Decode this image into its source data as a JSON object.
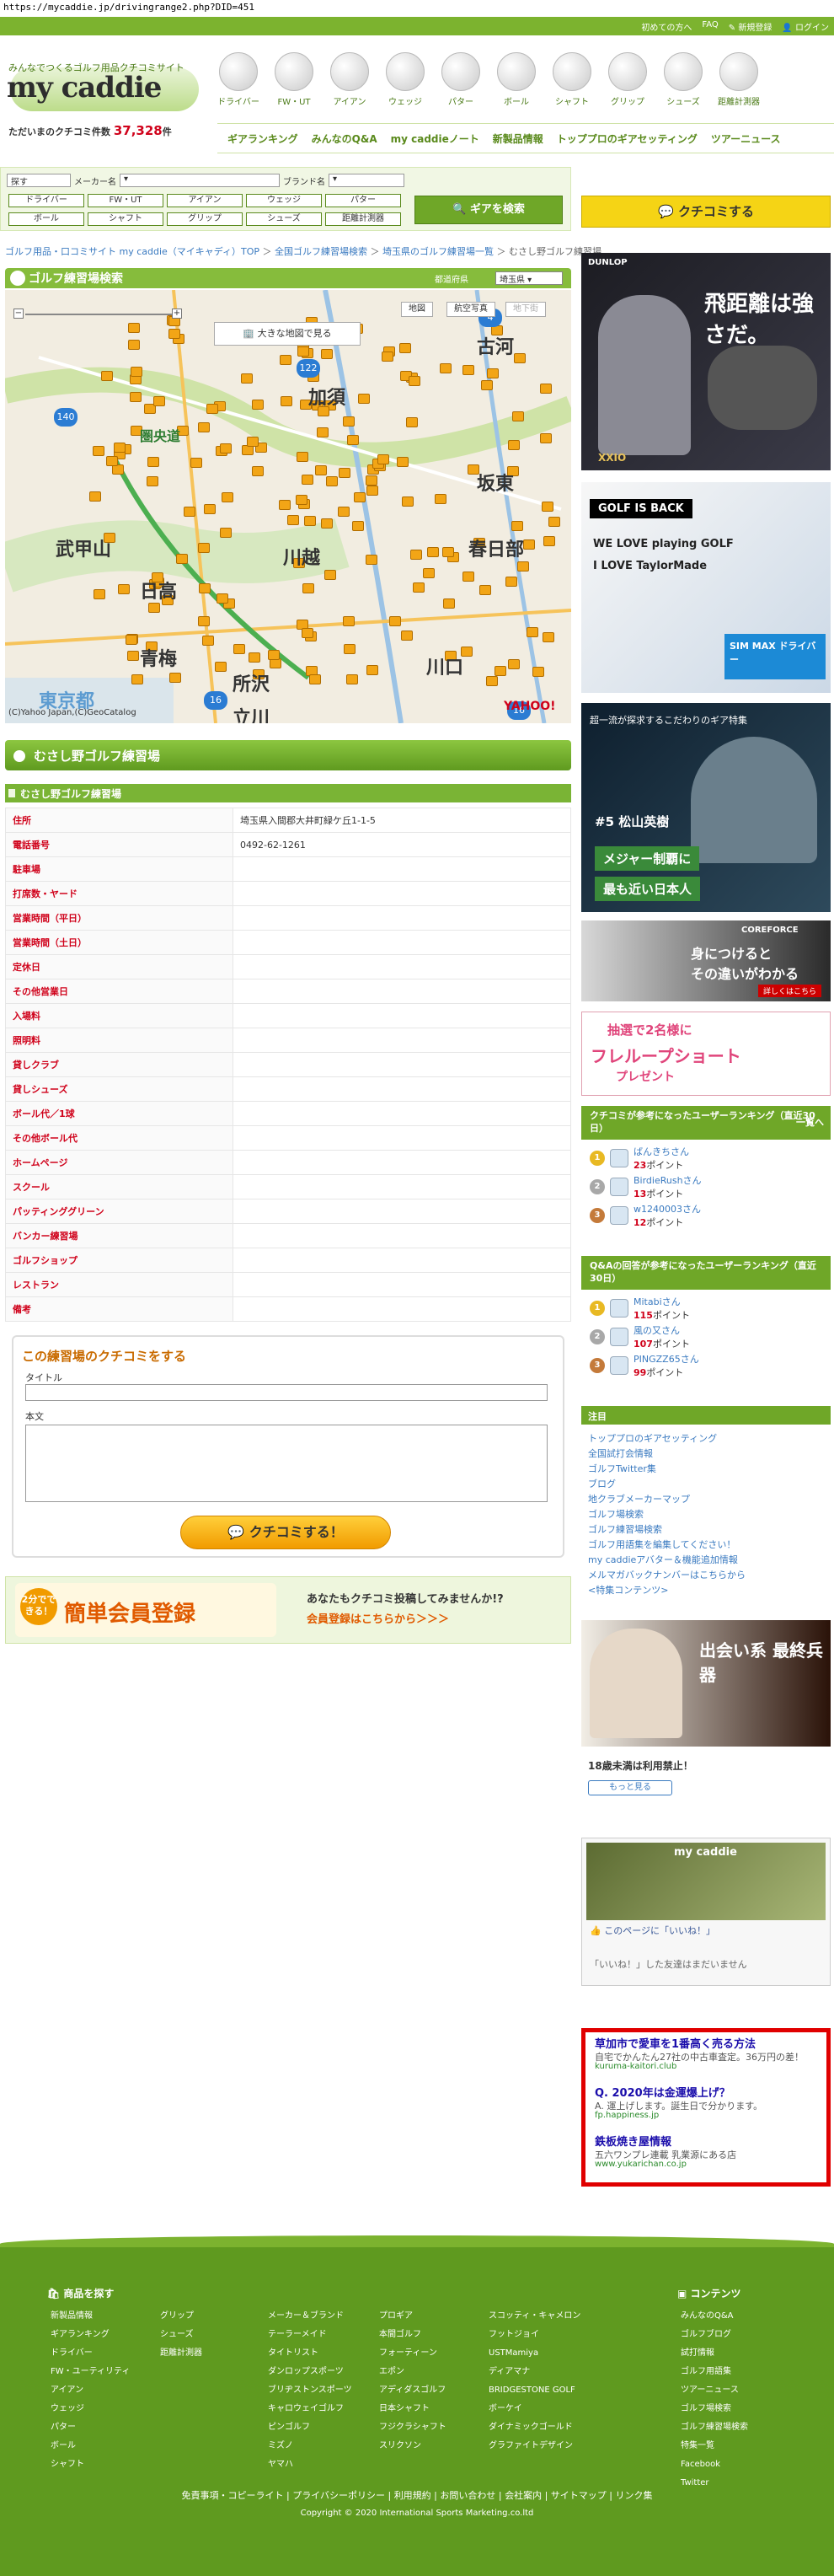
{
  "url": "https://mycaddie.jp/drivingrange2.php?DID=451",
  "top_links": [
    "初めての方へ",
    "FAQ",
    "新規登録",
    "ログイン"
  ],
  "logo": {
    "tagline": "みんなでつくるゴルフ用品クチコミサイト",
    "name": "my caddie"
  },
  "review_count": {
    "label": "ただいまのクチコミ件数",
    "value": "37,328",
    "unit": "件"
  },
  "categories": [
    "ドライバー",
    "FW・UT",
    "アイアン",
    "ウェッジ",
    "パター",
    "ボール",
    "シャフト",
    "グリップ",
    "シューズ",
    "距離計測器"
  ],
  "subnav": [
    "ギアランキング",
    "みんなのQ&A",
    "my caddieノート",
    "新製品情報",
    "トッププロのギアセッティング",
    "ツアーニュース"
  ],
  "search": {
    "filters": [
      {
        "label": "探す",
        "value": "探す"
      },
      {
        "label": "メーカー名",
        "value": ""
      },
      {
        "label": "ブランド名",
        "value": ""
      }
    ],
    "buttons": [
      "ドライバー",
      "FW・UT",
      "アイアン",
      "ウェッジ",
      "パター",
      "ボール",
      "シャフト",
      "グリップ",
      "シューズ",
      "距離計測器"
    ],
    "gear_search_label": "ギアを検索",
    "kuchikomi_label": "クチコミする"
  },
  "breadcrumb": [
    "ゴルフ用品・口コミサイト my caddie（マイキャディ）TOP",
    "全国ゴルフ練習場検索",
    "埼玉県のゴルフ練習場一覧",
    "むさし野ゴルフ練習場"
  ],
  "map": {
    "title": "ゴルフ練習場検索",
    "filter_label": "都道府県",
    "filter_value": "埼玉県",
    "types": [
      "地図",
      "航空写真",
      "地下街"
    ],
    "big_map_label": "大きな地図で見る",
    "credit": "(C)Yahoo Japan,(C)GeoCatalog",
    "brand": "YAHOO!",
    "places": [
      "古河",
      "加須",
      "坂東",
      "武甲山",
      "春日部",
      "日高",
      "川越",
      "青梅",
      "所沢",
      "川口",
      "東京都",
      "立川",
      "圏央道"
    ],
    "route_numbers": [
      "140",
      "122",
      "4",
      "16",
      "16"
    ]
  },
  "facility": {
    "name": "むさし野ゴルフ練習場",
    "subtitle": "むさし野ゴルフ練習場",
    "rows": [
      {
        "k": "住所",
        "v": "埼玉県入間郡大井町緑ケ丘1-1-5"
      },
      {
        "k": "電話番号",
        "v": "0492-62-1261"
      },
      {
        "k": "駐車場",
        "v": ""
      },
      {
        "k": "打席数・ヤード",
        "v": ""
      },
      {
        "k": "営業時間（平日）",
        "v": ""
      },
      {
        "k": "営業時間（土日）",
        "v": ""
      },
      {
        "k": "定休日",
        "v": ""
      },
      {
        "k": "その他営業日",
        "v": ""
      },
      {
        "k": "入場料",
        "v": ""
      },
      {
        "k": "照明料",
        "v": ""
      },
      {
        "k": "貸しクラブ",
        "v": ""
      },
      {
        "k": "貸しシューズ",
        "v": ""
      },
      {
        "k": "ボール代／1球",
        "v": ""
      },
      {
        "k": "その他ボール代",
        "v": ""
      },
      {
        "k": "ホームページ",
        "v": ""
      },
      {
        "k": "スクール",
        "v": ""
      },
      {
        "k": "パッティンググリーン",
        "v": ""
      },
      {
        "k": "バンカー練習場",
        "v": ""
      },
      {
        "k": "ゴルフショップ",
        "v": ""
      },
      {
        "k": "レストラン",
        "v": ""
      },
      {
        "k": "備考",
        "v": ""
      }
    ]
  },
  "review_form": {
    "title": "この練習場のクチコミをする",
    "title_label": "タイトル",
    "body_label": "本文",
    "submit_label": "クチコミする！"
  },
  "register": {
    "badge": "2分でできる！",
    "main": "簡単会員登録",
    "question": "あなたもクチコミ投稿してみませんか!?",
    "link": "会員登録はこちらから＞＞＞"
  },
  "ads": {
    "ad1": {
      "brand": "DUNLOP",
      "headline": "飛距離は強さだ。",
      "product": "XXIO"
    },
    "ad2": {
      "badge": "GOLF IS BACK",
      "line1": "WE LOVE playing GOLF",
      "line2": "I LOVE TaylorMade",
      "line3": "SIM MAX ドライバー"
    },
    "ad3": {
      "top": "超一流が探求するこだわりのギア特集",
      "player": "#5 松山英樹",
      "line1": "メジャー制覇に",
      "line2": "最も近い日本人"
    },
    "ad4": {
      "brand": "COREFORCE",
      "line1": "身につけると",
      "line2": "その違いがわかる",
      "cta": "詳しくはこちら"
    },
    "ad5": {
      "line1": "抽選で2名様に",
      "line2": "フレループショート",
      "line3": "プレゼント"
    }
  },
  "ranking_review": {
    "title": "クチコミが参考になったユーザーランキング（直近30日）",
    "more": "一覧へ",
    "rows": [
      {
        "rank": "1",
        "name": "ばんきちさん",
        "points": "23",
        "unit": "ポイント"
      },
      {
        "rank": "2",
        "name": "BirdieRushさん",
        "points": "13",
        "unit": "ポイント"
      },
      {
        "rank": "3",
        "name": "w1240003さん",
        "points": "12",
        "unit": "ポイント"
      }
    ]
  },
  "ranking_qa": {
    "title": "Q&Aの回答が参考になったユーザーランキング（直近30日）",
    "rows": [
      {
        "rank": "1",
        "name": "Mitabiさん",
        "points": "115",
        "unit": "ポイント"
      },
      {
        "rank": "2",
        "name": "風の又さん",
        "points": "107",
        "unit": "ポイント"
      },
      {
        "rank": "3",
        "name": "PINGZZ65さん",
        "points": "99",
        "unit": "ポイント"
      }
    ]
  },
  "notice": {
    "title": "注目",
    "items": [
      "トッププロのギアセッティング",
      "全国試打会情報",
      "ゴルフTwitter集",
      "ブログ",
      "地クラブメーカーマップ",
      "ゴルフ場検索",
      "ゴルフ練習場検索",
      "ゴルフ用語集を編集してください！",
      "my caddieアバター＆機能追加情報",
      "メルマガバックナンバーはこちらから",
      "<特集コンテンツ>"
    ]
  },
  "ad6": {
    "caption": "18歳未満は利用禁止！",
    "button": "もっと見る",
    "headline": "出会い系 最終兵器"
  },
  "facebook": {
    "title": "my caddie",
    "like": "このページに「いいね！」",
    "none": "「いいね！」した友達はまだいません"
  },
  "text_ads": [
    {
      "title": "草加市で愛車を1番高く売る方法",
      "desc": "自宅でかんたん27社の中古車査定。36万円の差！",
      "url": "kuruma-kaitori.club"
    },
    {
      "title": "Q. 2020年は金運爆上げ？",
      "desc": "A. 運上げします。誕生日で分かります。",
      "url": "fp.happiness.jp"
    },
    {
      "title": "鉄板焼き屋情報",
      "desc": "五六ワンプレ連載 乳業源にある店",
      "url": "www.yukarichan.co.jp"
    }
  ],
  "footer": {
    "products_title": "商品を探す",
    "contents_title": "コンテンツ",
    "col1": [
      "新製品情報",
      "ギアランキング",
      "ドライバー",
      "FW・ユーティリティ",
      "アイアン",
      "ウェッジ",
      "パター",
      "ボール",
      "シャフト"
    ],
    "col2": [
      "グリップ",
      "シューズ",
      "距離計測器"
    ],
    "col3": [
      "メーカー＆ブランド",
      "テーラーメイド",
      "タイトリスト",
      "ダンロップスポーツ",
      "ブリヂストンスポーツ",
      "キャロウェイゴルフ",
      "ピンゴルフ",
      "ミズノ",
      "ヤマハ"
    ],
    "col4": [
      "プロギア",
      "本間ゴルフ",
      "フォーティーン",
      "エポン",
      "アディダスゴルフ",
      "日本シャフト",
      "フジクラシャフト",
      "スリクソン"
    ],
    "col5": [
      "スコッティ・キャメロン",
      "フットジョイ",
      "USTMamiya",
      "ディアマナ",
      "BRIDGESTONE GOLF",
      "ボーケイ",
      "ダイナミックゴールド",
      "グラファイトデザイン"
    ],
    "col6": [
      "みんなのQ&A",
      "ゴルフブログ",
      "試打情報",
      "ゴルフ用語集",
      "ツアーニュース",
      "ゴルフ場検索",
      "ゴルフ練習場検索",
      "特集一覧",
      "Facebook",
      "Twitter"
    ],
    "links": [
      "免責事項・コピーライト",
      "プライバシーポリシー",
      "利用規約",
      "お問い合わせ",
      "会社案内",
      "サイトマップ",
      "リンク集"
    ],
    "copyright": "Copyright © 2020 International Sports Marketing.co.ltd"
  }
}
